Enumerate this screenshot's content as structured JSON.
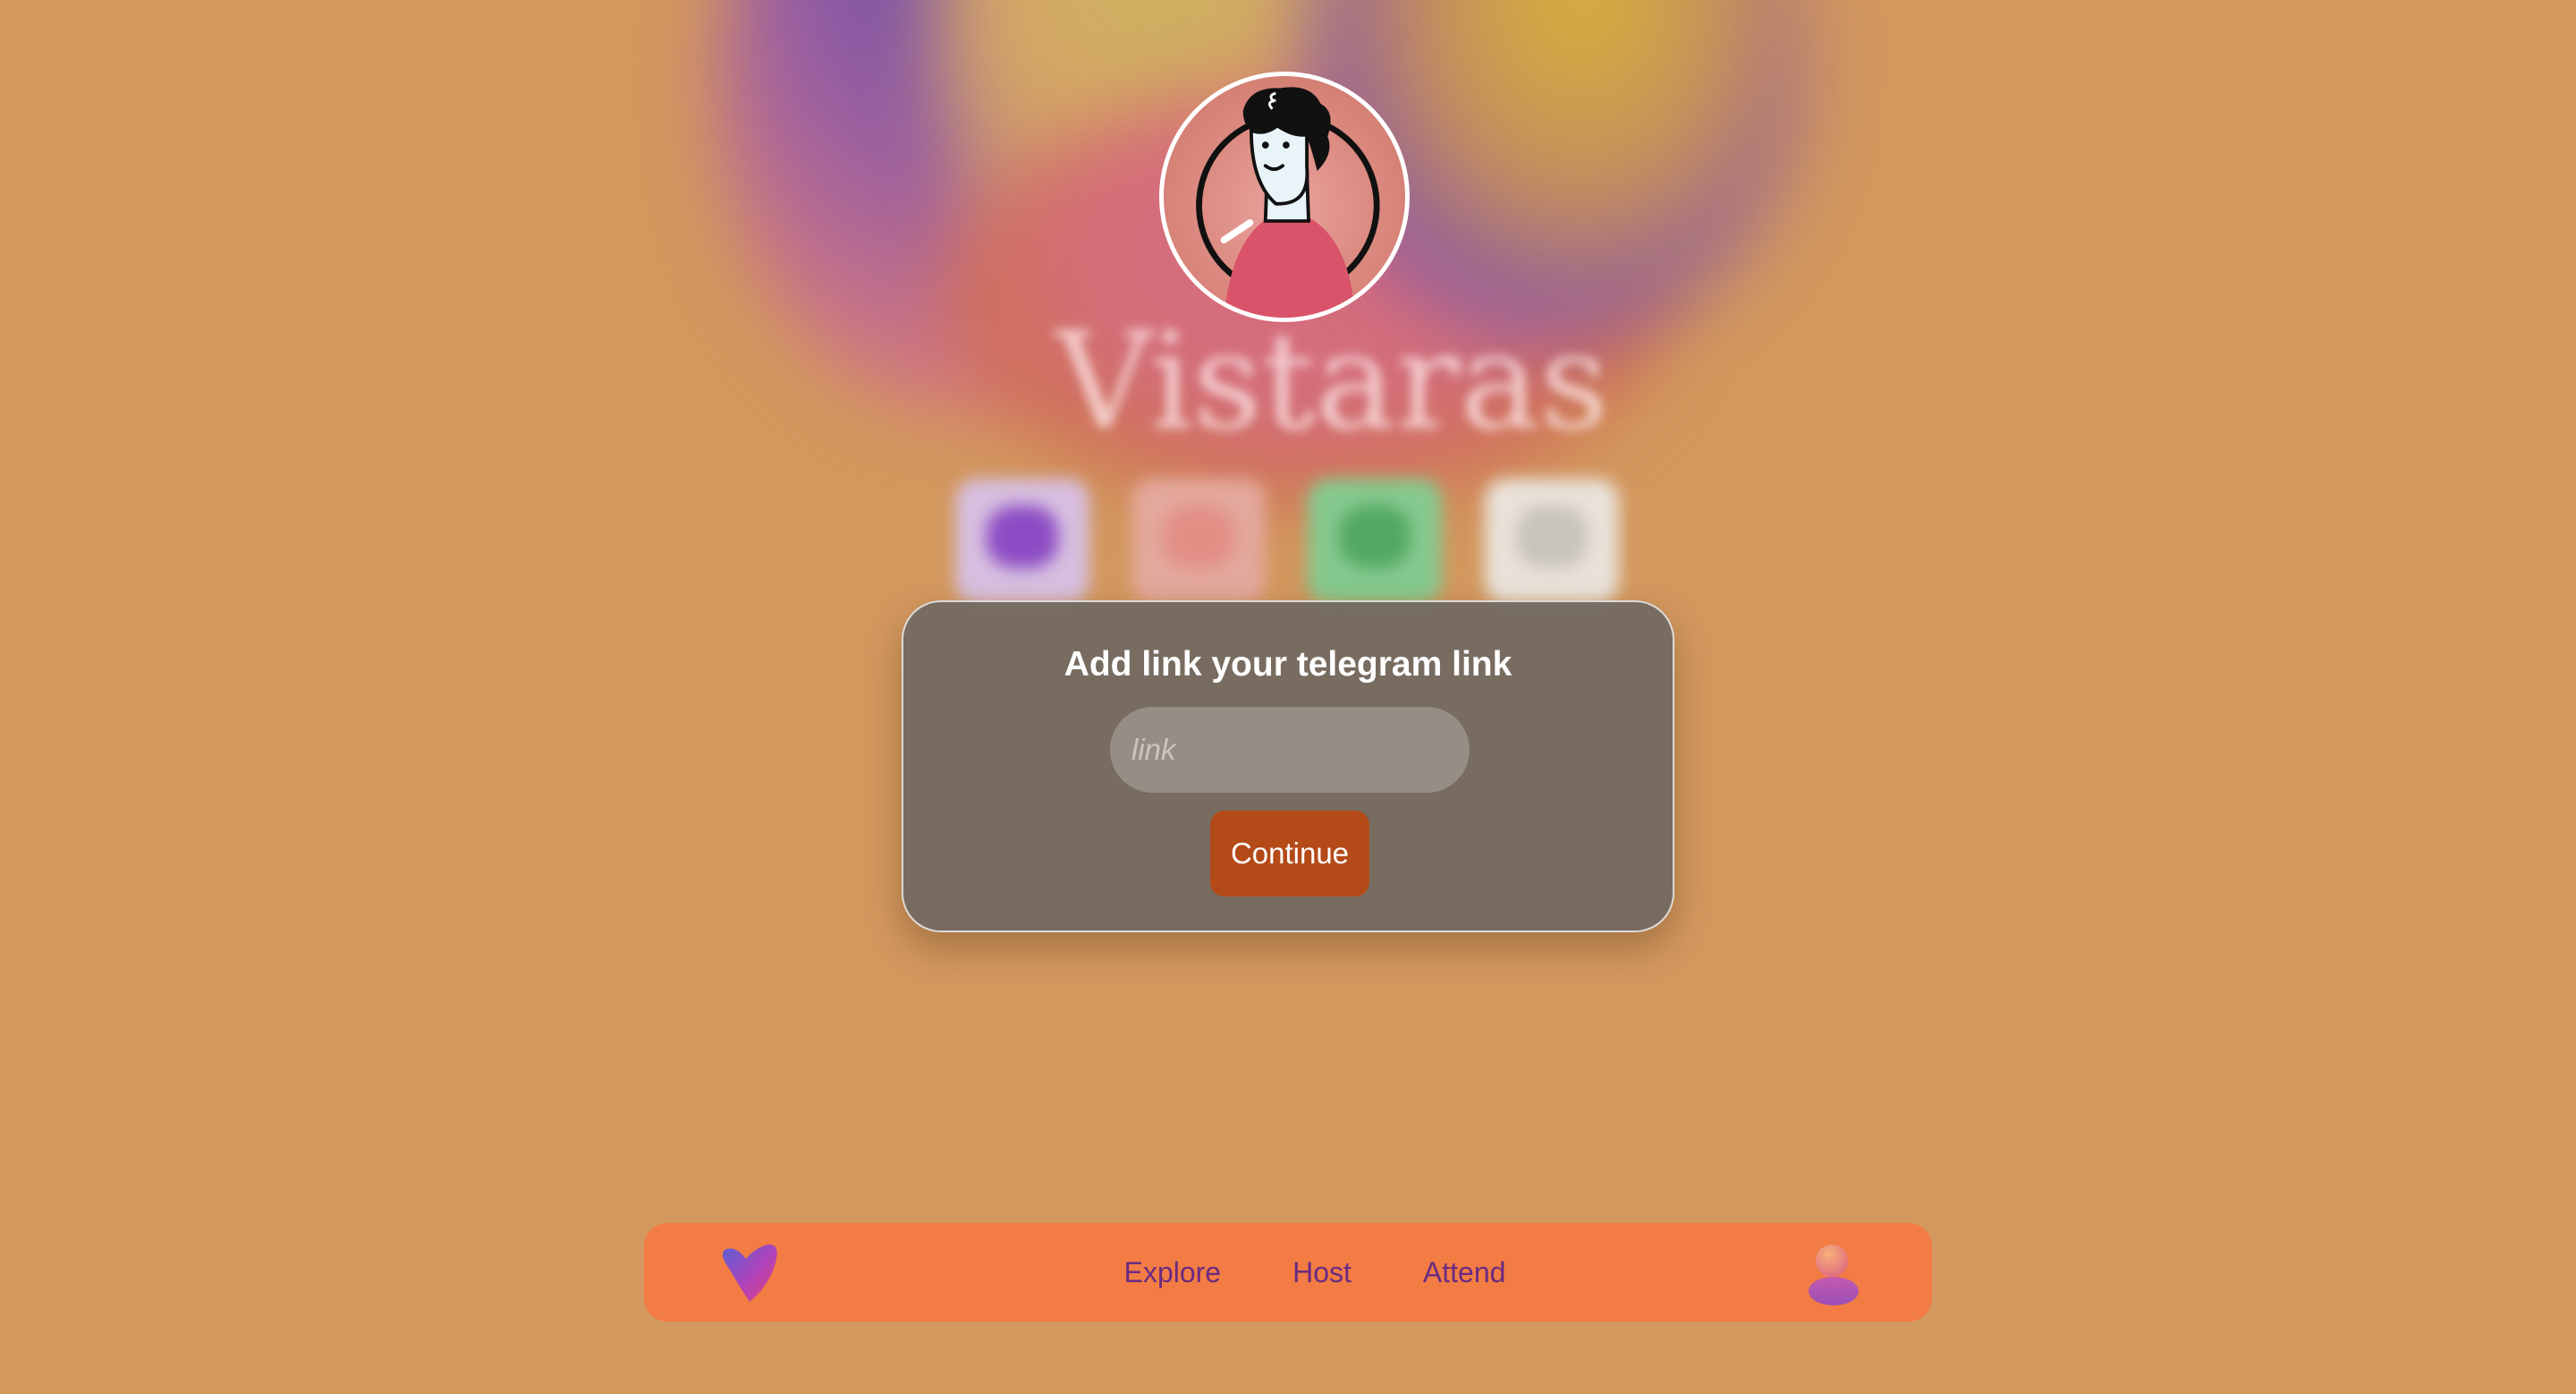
{
  "background": {
    "blurred_title": "Vistaras"
  },
  "modal": {
    "title": "Add link your telegram link",
    "input_placeholder": "link",
    "input_value": "",
    "continue_label": "Continue"
  },
  "navbar": {
    "links": [
      {
        "label": "Explore"
      },
      {
        "label": "Host"
      },
      {
        "label": "Attend"
      }
    ],
    "logo_icon": "heart-logo-icon",
    "avatar_icon": "user-avatar-icon"
  },
  "colors": {
    "page_background": "#D3985E",
    "navbar_background": "#F27C43",
    "nav_link_color": "#6A2A82",
    "continue_button": "#B44A18",
    "modal_background": "#6E6760"
  }
}
